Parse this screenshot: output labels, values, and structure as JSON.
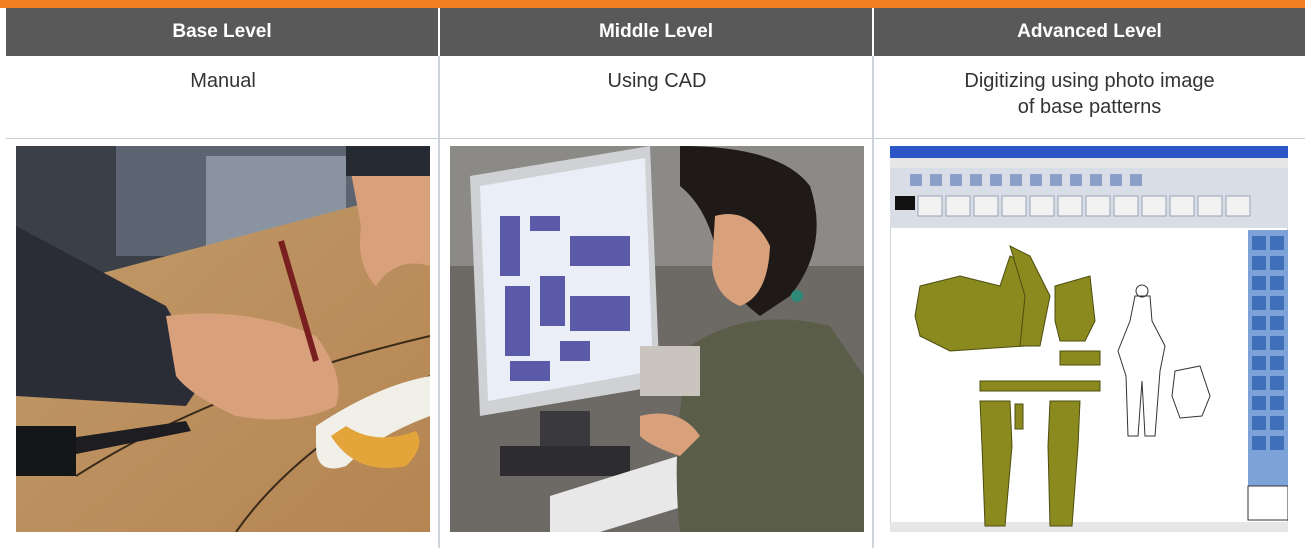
{
  "columns": [
    {
      "header": "Base Level",
      "description": [
        "Manual"
      ]
    },
    {
      "header": "Middle Level",
      "description": [
        "Using CAD"
      ]
    },
    {
      "header": "Advanced Level",
      "description": [
        "Digitizing using photo image",
        "of base patterns"
      ]
    }
  ],
  "colors": {
    "accent": "#f07f22",
    "header_bg": "#595959",
    "header_text": "#ffffff",
    "pattern_fill": "#8a8a1e"
  },
  "images": [
    {
      "icon": "manual-drafting-photo"
    },
    {
      "icon": "cad-workstation-photo"
    },
    {
      "icon": "pattern-digitizing-software-screenshot"
    }
  ]
}
